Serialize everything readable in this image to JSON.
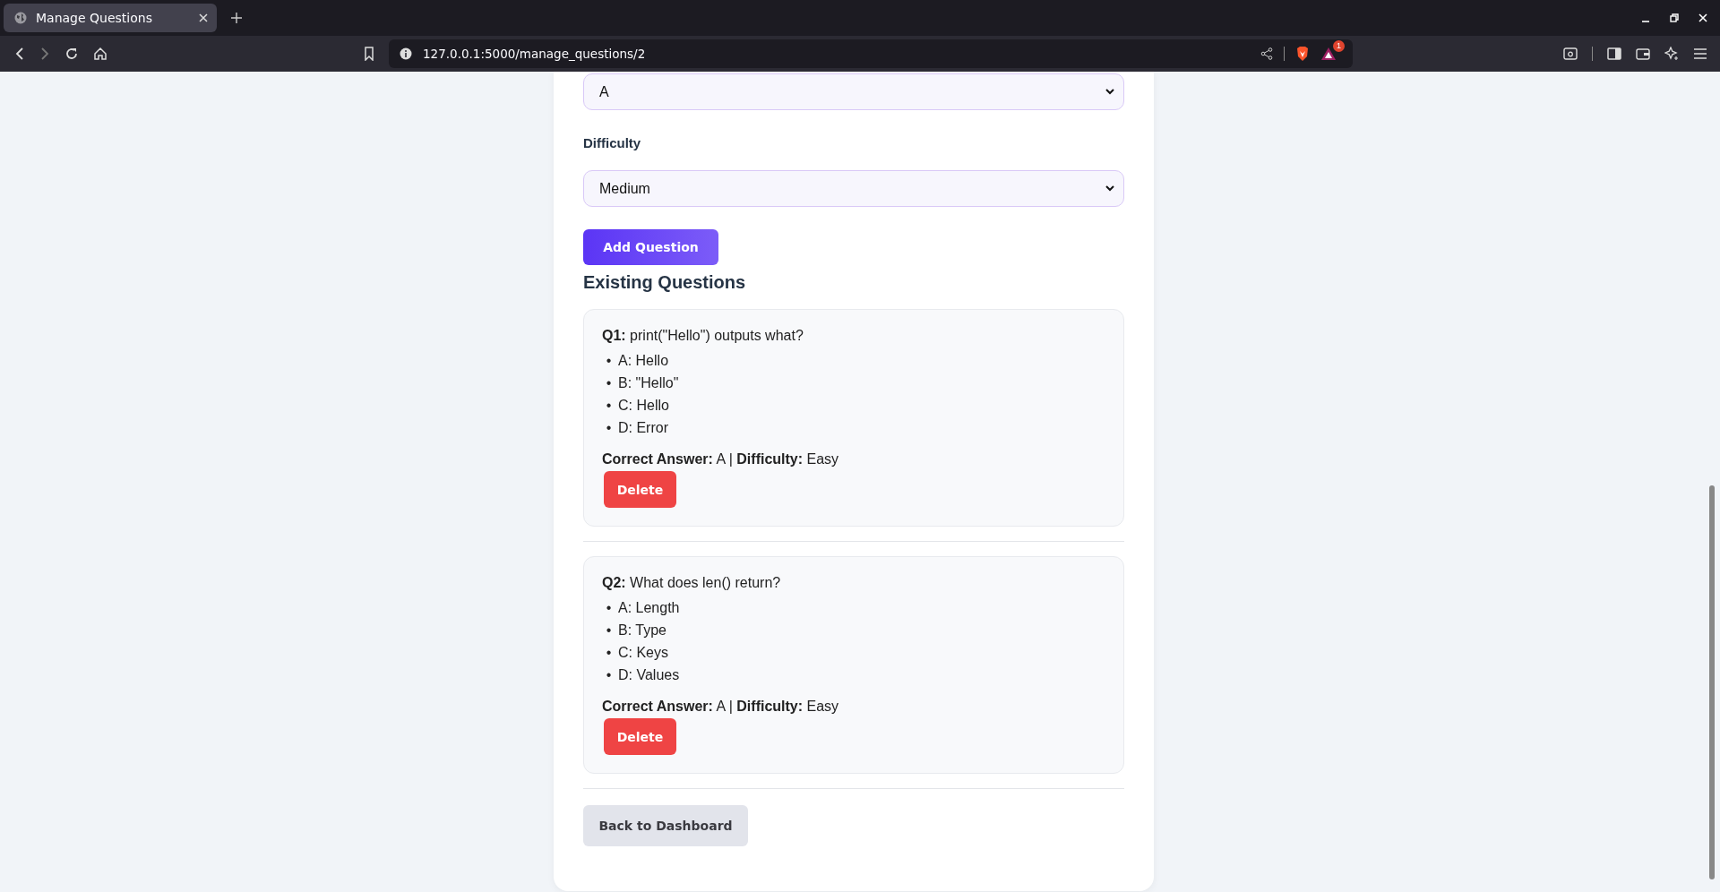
{
  "browser": {
    "tab": {
      "title": "Manage Questions",
      "selected": true
    },
    "url": "127.0.0.1:5000/manage_questions/2",
    "badge": "1"
  },
  "form": {
    "fields": [
      {
        "value": "A"
      },
      {
        "label": "Difficulty",
        "value": "Medium"
      }
    ],
    "submit": "Add Question"
  },
  "section_title": "Existing Questions",
  "questions": [
    {
      "heading": "**Q1:** print(\"Hello\") outputs what?",
      "options": [
        {
          "marker": "•",
          "text": "A: Hello"
        },
        {
          "marker": "•",
          "text": "B: \"Hello\""
        },
        {
          "marker": "•",
          "text": "C: Hello"
        },
        {
          "marker": "•",
          "text": "D: Error"
        }
      ],
      "meta": "**Correct Answer:** A | **Difficulty:** Easy",
      "delete": "Delete"
    },
    {
      "heading": "**Q2:** What does len() return?",
      "options": [
        {
          "marker": "•",
          "text": "A: Length"
        },
        {
          "marker": "•",
          "text": "B: Type"
        },
        {
          "marker": "•",
          "text": "C: Keys"
        },
        {
          "marker": "•",
          "text": "D: Values"
        }
      ],
      "meta": "**Correct Answer:** A | **Difficulty:** Easy",
      "delete": "Delete"
    }
  ],
  "back_button": "Back to Dashboard"
}
